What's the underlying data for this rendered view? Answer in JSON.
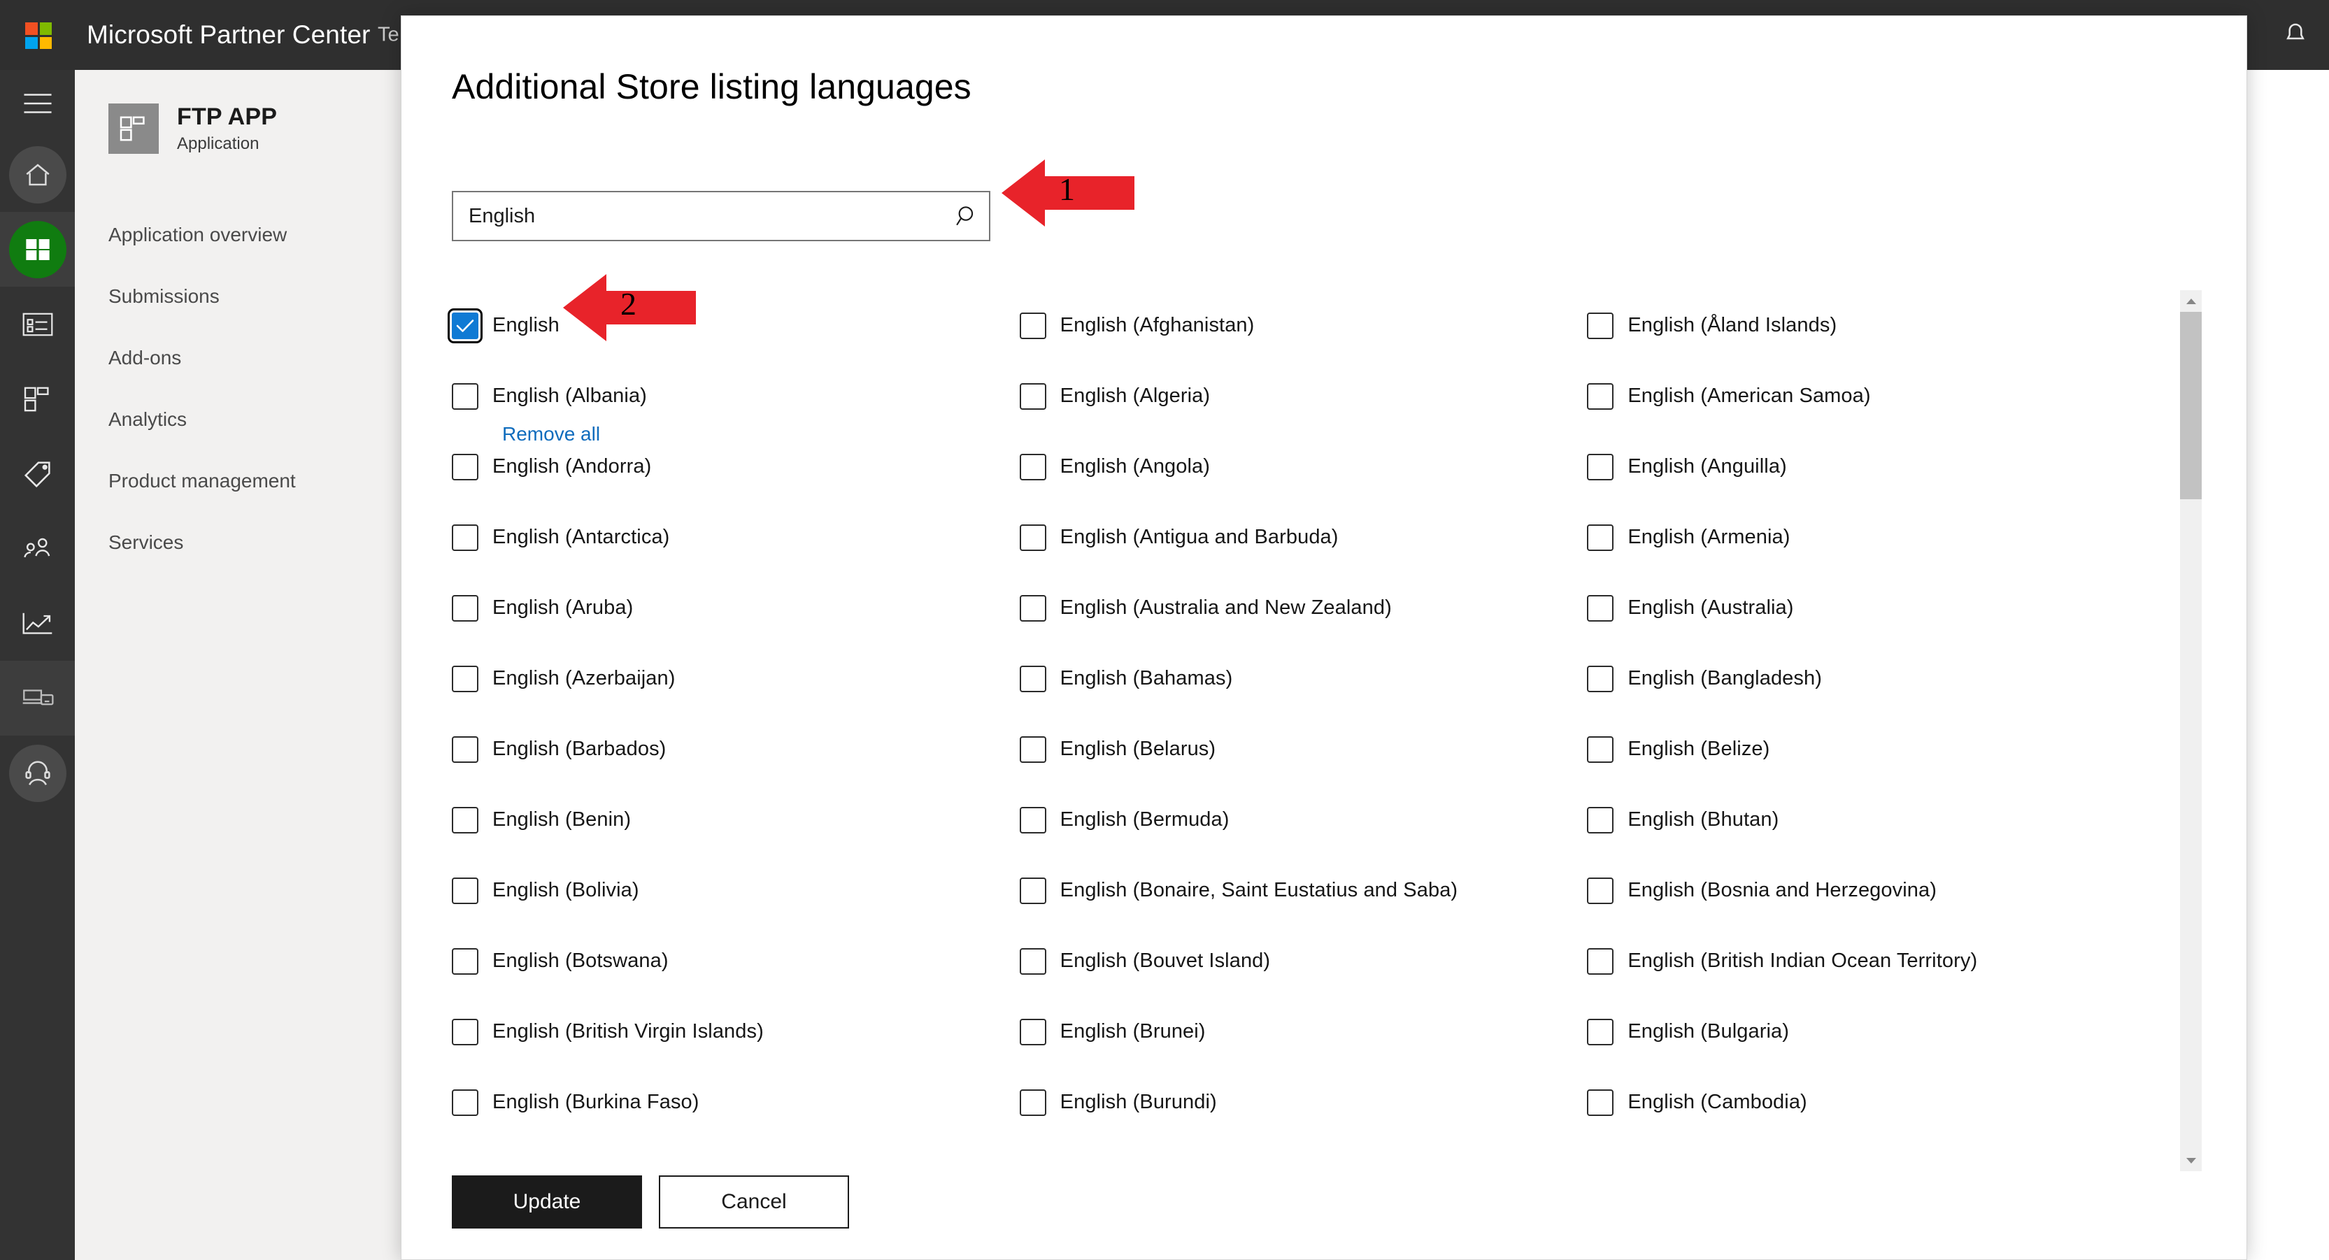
{
  "topbar": {
    "brand": "Microsoft Partner Center",
    "sub": "Te",
    "logo_colors": [
      "#F25022",
      "#7FBA00",
      "#00A4EF",
      "#FFB900"
    ],
    "right_icon": "bell-icon"
  },
  "rail": {
    "items": [
      {
        "icon": "hamburger-icon",
        "name": "menu-toggle"
      },
      {
        "icon": "home-icon",
        "name": "rail-item-home"
      },
      {
        "icon": "windows-icon",
        "name": "rail-item-windows"
      },
      {
        "icon": "form-icon",
        "name": "rail-item-listing"
      },
      {
        "icon": "grid-icon",
        "name": "rail-item-apps"
      },
      {
        "icon": "tag-icon",
        "name": "rail-item-offers"
      },
      {
        "icon": "people-icon",
        "name": "rail-item-users"
      },
      {
        "icon": "analytics-icon",
        "name": "rail-item-analytics"
      },
      {
        "icon": "devices-icon",
        "name": "rail-item-devices"
      },
      {
        "icon": "support-icon",
        "name": "rail-item-support"
      }
    ]
  },
  "navpanel": {
    "app_name": "FTP APP",
    "app_kind": "Application",
    "app_tile_icon": "grid-icon",
    "items": [
      {
        "label": "Application overview"
      },
      {
        "label": "Submissions"
      },
      {
        "label": "Add-ons"
      },
      {
        "label": "Analytics"
      },
      {
        "label": "Product management"
      },
      {
        "label": "Services"
      }
    ]
  },
  "modal": {
    "title": "Additional Store listing languages",
    "search": {
      "value": "English",
      "placeholder": "Search",
      "icon": "search-icon"
    },
    "remove_all_label": "Remove all",
    "buttons": {
      "update": "Update",
      "cancel": "Cancel"
    },
    "scrollbar": {
      "up_icon": "chevron-up-icon",
      "down_icon": "chevron-down-icon"
    }
  },
  "languages": [
    {
      "label": "English",
      "checked": true
    },
    {
      "label": "English (Albania)",
      "checked": false
    },
    {
      "label": "English (Andorra)",
      "checked": false
    },
    {
      "label": "English (Antarctica)",
      "checked": false
    },
    {
      "label": "English (Aruba)",
      "checked": false
    },
    {
      "label": "English (Azerbaijan)",
      "checked": false
    },
    {
      "label": "English (Barbados)",
      "checked": false
    },
    {
      "label": "English (Benin)",
      "checked": false
    },
    {
      "label": "English (Bolivia)",
      "checked": false
    },
    {
      "label": "English (Botswana)",
      "checked": false
    },
    {
      "label": "English (British Virgin Islands)",
      "checked": false
    },
    {
      "label": "English (Burkina Faso)",
      "checked": false
    },
    {
      "label": "English (Afghanistan)",
      "checked": false
    },
    {
      "label": "English (Algeria)",
      "checked": false
    },
    {
      "label": "English (Angola)",
      "checked": false
    },
    {
      "label": "English (Antigua and Barbuda)",
      "checked": false
    },
    {
      "label": "English (Australia and New Zealand)",
      "checked": false
    },
    {
      "label": "English (Bahamas)",
      "checked": false
    },
    {
      "label": "English (Belarus)",
      "checked": false
    },
    {
      "label": "English (Bermuda)",
      "checked": false
    },
    {
      "label": "English (Bonaire, Saint Eustatius and Saba)",
      "checked": false
    },
    {
      "label": "English (Bouvet Island)",
      "checked": false
    },
    {
      "label": "English (Brunei)",
      "checked": false
    },
    {
      "label": "English (Burundi)",
      "checked": false
    },
    {
      "label": "English (Åland Islands)",
      "checked": false
    },
    {
      "label": "English (American Samoa)",
      "checked": false
    },
    {
      "label": "English (Anguilla)",
      "checked": false
    },
    {
      "label": "English (Armenia)",
      "checked": false
    },
    {
      "label": "English (Australia)",
      "checked": false
    },
    {
      "label": "English (Bangladesh)",
      "checked": false
    },
    {
      "label": "English (Belize)",
      "checked": false
    },
    {
      "label": "English (Bhutan)",
      "checked": false
    },
    {
      "label": "English (Bosnia and Herzegovina)",
      "checked": false
    },
    {
      "label": "English (British Indian Ocean Territory)",
      "checked": false
    },
    {
      "label": "English (Bulgaria)",
      "checked": false
    },
    {
      "label": "English (Cambodia)",
      "checked": false
    }
  ],
  "annotations": [
    {
      "number": "1",
      "color": "#E8232A",
      "target": "search-input"
    },
    {
      "number": "2",
      "color": "#E8232A",
      "target": "english-checkbox"
    }
  ]
}
